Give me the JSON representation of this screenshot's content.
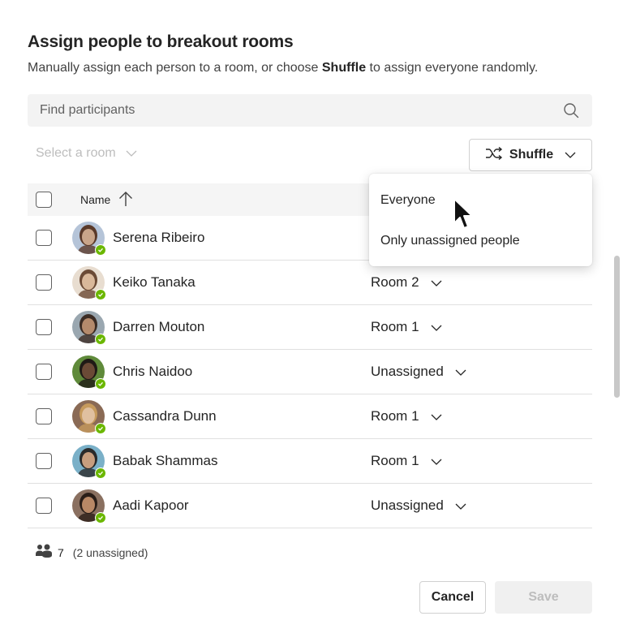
{
  "dialog": {
    "title": "Assign people to breakout rooms",
    "subtitle_before": "Manually assign each person to a room, or choose ",
    "subtitle_bold": "Shuffle",
    "subtitle_after": " to assign everyone randomly."
  },
  "search": {
    "placeholder": "Find participants",
    "value": "",
    "icon": "search-icon"
  },
  "toolbar": {
    "room_select_placeholder": "Select a room",
    "shuffle_label": "Shuffle",
    "shuffle_icon": "shuffle-icon"
  },
  "shuffle_menu": {
    "items": [
      {
        "label": "Everyone"
      },
      {
        "label": "Only unassigned people"
      }
    ]
  },
  "table": {
    "header": {
      "name_label": "Name",
      "sort": "ascending"
    },
    "rows": [
      {
        "name": "Serena Ribeiro",
        "room": "",
        "status": "available",
        "checked": false
      },
      {
        "name": "Keiko Tanaka",
        "room": "Room 2",
        "status": "available",
        "checked": false
      },
      {
        "name": "Darren Mouton",
        "room": "Room 1",
        "status": "available",
        "checked": false
      },
      {
        "name": "Chris Naidoo",
        "room": "Unassigned",
        "status": "available",
        "checked": false
      },
      {
        "name": "Cassandra Dunn",
        "room": "Room 1",
        "status": "available",
        "checked": false
      },
      {
        "name": "Babak Shammas",
        "room": "Room 1",
        "status": "available",
        "checked": false
      },
      {
        "name": "Aadi Kapoor",
        "room": "Unassigned",
        "status": "available",
        "checked": false
      }
    ]
  },
  "footer": {
    "participant_count": "7",
    "unassigned_text": "(2 unassigned)",
    "cancel_label": "Cancel",
    "save_label": "Save"
  },
  "colors": {
    "presence_available": "#6bb700",
    "disabled_text": "#bdbdbd"
  }
}
